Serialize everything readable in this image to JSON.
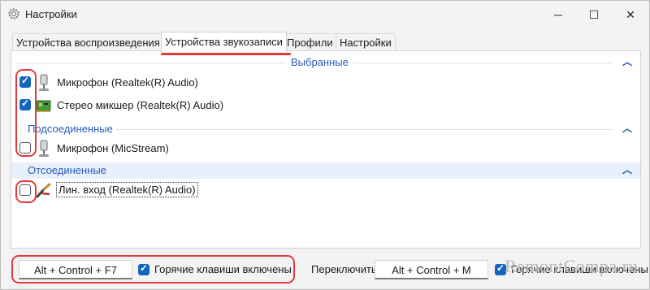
{
  "window": {
    "title": "Настройки"
  },
  "tabs": [
    {
      "label": "Устройства воспроизведения"
    },
    {
      "label": "Устройства звукозаписи"
    },
    {
      "label": "Профили"
    },
    {
      "label": "Настройки"
    }
  ],
  "groups": {
    "selected": {
      "title": "Выбранные"
    },
    "connected": {
      "title": "Подсоединенные"
    },
    "disconnected": {
      "title": "Отсоединенные"
    }
  },
  "devices": [
    {
      "label": "Микрофон (Realtek(R) Audio)",
      "checked": true,
      "icon": "microphone-icon"
    },
    {
      "label": "Стерео микшер (Realtek(R) Audio)",
      "checked": true,
      "icon": "sound-card-icon"
    },
    {
      "label": "Микрофон (MicStream)",
      "checked": false,
      "icon": "microphone-icon"
    },
    {
      "label": "Лин. вход (Realtek(R) Audio)",
      "checked": false,
      "icon": "line-in-cable-icon"
    }
  ],
  "bottom": {
    "hotkey1": "Alt + Control + F7",
    "hotkey1_enabled_label": "Горячие клавиши включены",
    "switch_label": "Переключить",
    "hotkey2": "Alt + Control + M",
    "hotkey2_enabled_label": "Горячие клавиши включены"
  },
  "watermark": "RemontCompa.ru",
  "colors": {
    "accent": "#1565c0",
    "highlight": "#e03c3c",
    "group_text": "#2a5bb8"
  }
}
